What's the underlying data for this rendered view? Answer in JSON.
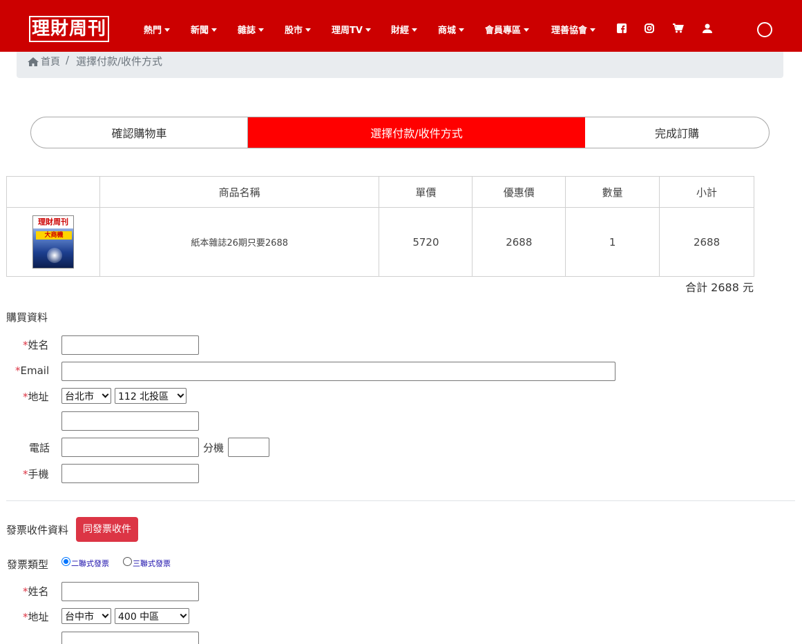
{
  "header": {
    "logo": "理財周刊",
    "nav": [
      "熱門",
      "新聞",
      "雜誌",
      "股市",
      "理周TV",
      "財經",
      "商城",
      "會員專區",
      "理善協會"
    ],
    "bg_color": "#cc0000",
    "icons": [
      "facebook-icon",
      "instagram-icon",
      "cart-icon",
      "user-icon",
      "circle-icon"
    ]
  },
  "breadcrumb": {
    "home": "首頁",
    "separator": "/",
    "current": "選擇付款/收件方式"
  },
  "steps": [
    "確認購物車",
    "選擇付款/收件方式",
    "完成訂購"
  ],
  "cart": {
    "headers": [
      "",
      "商品名稱",
      "單價",
      "優惠價",
      "數量",
      "小計"
    ],
    "rows": [
      {
        "thumb_title": "理財周刊",
        "thumb_headline": "大商機",
        "name": "紙本雜誌26期只要2688",
        "price": "5720",
        "discount": "2688",
        "qty": "1",
        "subtotal": "2688"
      }
    ],
    "total": "合計 2688 元"
  },
  "purchase": {
    "title": "購買資料",
    "asterisk": "*",
    "name_label": "姓名",
    "email_label": "Email",
    "address_label": "地址",
    "city": "台北市",
    "district": "112 北投區",
    "phone_label": "電話",
    "ext_label": "分機",
    "mobile_label": "手機"
  },
  "invoice": {
    "title": "發票收件資料",
    "same_button": "同發票收件",
    "type_label": "發票類型",
    "type_options": [
      "二聯式發票",
      "三聯式發票"
    ],
    "name_label": "姓名",
    "address_label": "地址",
    "city": "台中市",
    "district": "400 中區"
  }
}
